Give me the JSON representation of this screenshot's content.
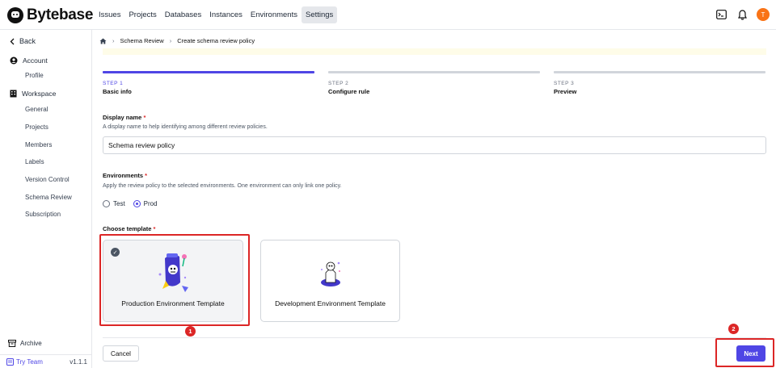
{
  "app": {
    "name": "Bytebase"
  },
  "nav": [
    {
      "label": "Issues",
      "active": false
    },
    {
      "label": "Projects",
      "active": false
    },
    {
      "label": "Databases",
      "active": false
    },
    {
      "label": "Instances",
      "active": false
    },
    {
      "label": "Environments",
      "active": false
    },
    {
      "label": "Settings",
      "active": true
    }
  ],
  "user": {
    "avatar_initial": "T",
    "avatar_color": "#f97316"
  },
  "sidebar": {
    "back_label": "Back",
    "account_label": "Account",
    "account_items": [
      "Profile"
    ],
    "workspace_label": "Workspace",
    "workspace_items": [
      "General",
      "Projects",
      "Members",
      "Labels",
      "Version Control",
      "Schema Review",
      "Subscription"
    ],
    "archive_label": "Archive",
    "try_team_label": "Try Team",
    "version": "v1.1.1"
  },
  "breadcrumb": {
    "items": [
      "Schema Review",
      "Create schema review policy"
    ]
  },
  "steps": [
    {
      "num": "STEP 1",
      "name": "Basic info",
      "active": true
    },
    {
      "num": "STEP 2",
      "name": "Configure rule",
      "active": false
    },
    {
      "num": "STEP 3",
      "name": "Preview",
      "active": false
    }
  ],
  "form": {
    "display_name_label": "Display name",
    "display_name_help": "A display name to help identifying among different review policies.",
    "display_name_value": "Schema review policy",
    "environments_label": "Environments",
    "environments_help": "Apply the review policy to the selected environments. One environment can only link one policy.",
    "environment_options": [
      {
        "label": "Test",
        "selected": false
      },
      {
        "label": "Prod",
        "selected": true
      }
    ],
    "template_label": "Choose template",
    "templates": [
      {
        "label": "Production Environment Template",
        "selected": true
      },
      {
        "label": "Development Environment Template",
        "selected": false
      }
    ],
    "required_mark": "*"
  },
  "actions": {
    "cancel_label": "Cancel",
    "next_label": "Next"
  },
  "annotations": {
    "marker_1": "1",
    "marker_2": "2"
  },
  "colors": {
    "accent": "#4f46e5",
    "highlight": "#dc2626"
  }
}
